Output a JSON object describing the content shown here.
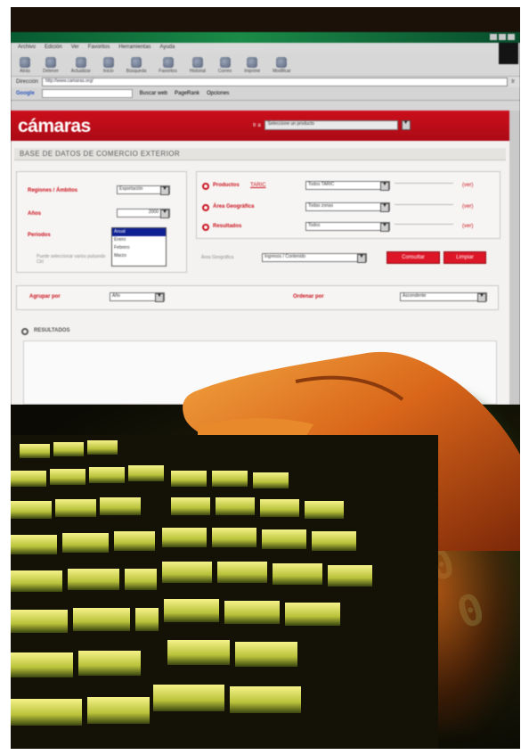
{
  "browser": {
    "menu": [
      "Archivo",
      "Edición",
      "Ver",
      "Favoritos",
      "Herramientas",
      "Ayuda"
    ],
    "toolbar": [
      "Atrás",
      "Detener",
      "Actualizar",
      "Inicio",
      "Búsqueda",
      "Favoritos",
      "Historial",
      "Correo",
      "Imprimir",
      "Modificar"
    ],
    "address_label": "Dirección",
    "address_value": "http://www.camaras.org/",
    "address_go": "Ir",
    "google_label": "Google",
    "google_search": "Buscar web",
    "google_extra": [
      "PageRank",
      "Opciones"
    ]
  },
  "site": {
    "brand": "cámaras",
    "select_label": "Ir a",
    "select_value": "Seleccione un producto",
    "section_title": "BASE DE DATOS DE COMERCIO EXTERIOR",
    "form": {
      "region_label": "Regiones / Ámbitos",
      "region_value": "Exportación",
      "year_label": "Años",
      "year_value": "2000",
      "period_label": "Periodos",
      "period_options": [
        "Anual",
        "Enero",
        "Febrero",
        "Marzo"
      ],
      "period_hint": "Puede seleccionar varios pulsando Ctrl",
      "product_label": "Productos",
      "product_link": "TARIC",
      "product_value": "Todos TARIC",
      "area_label": "Área Geográfica",
      "area_value": "Todas zonas",
      "area_check": "Área Geográfica",
      "area_check_value": "Todos",
      "result_label": "Resultados",
      "result_value": "Ingresos / Contenido",
      "link_sel": "(ver)",
      "btn_consult": "Consultar",
      "btn_print": "Limpiar",
      "group_label": "Agrupar por",
      "group_value": "Año",
      "sort_label": "Ordenar por",
      "sort_value": "Ascendente",
      "results_header": "RESULTADOS"
    }
  },
  "colors": {
    "brand_red": "#c2121e",
    "title_green": "#1f8a4a"
  }
}
